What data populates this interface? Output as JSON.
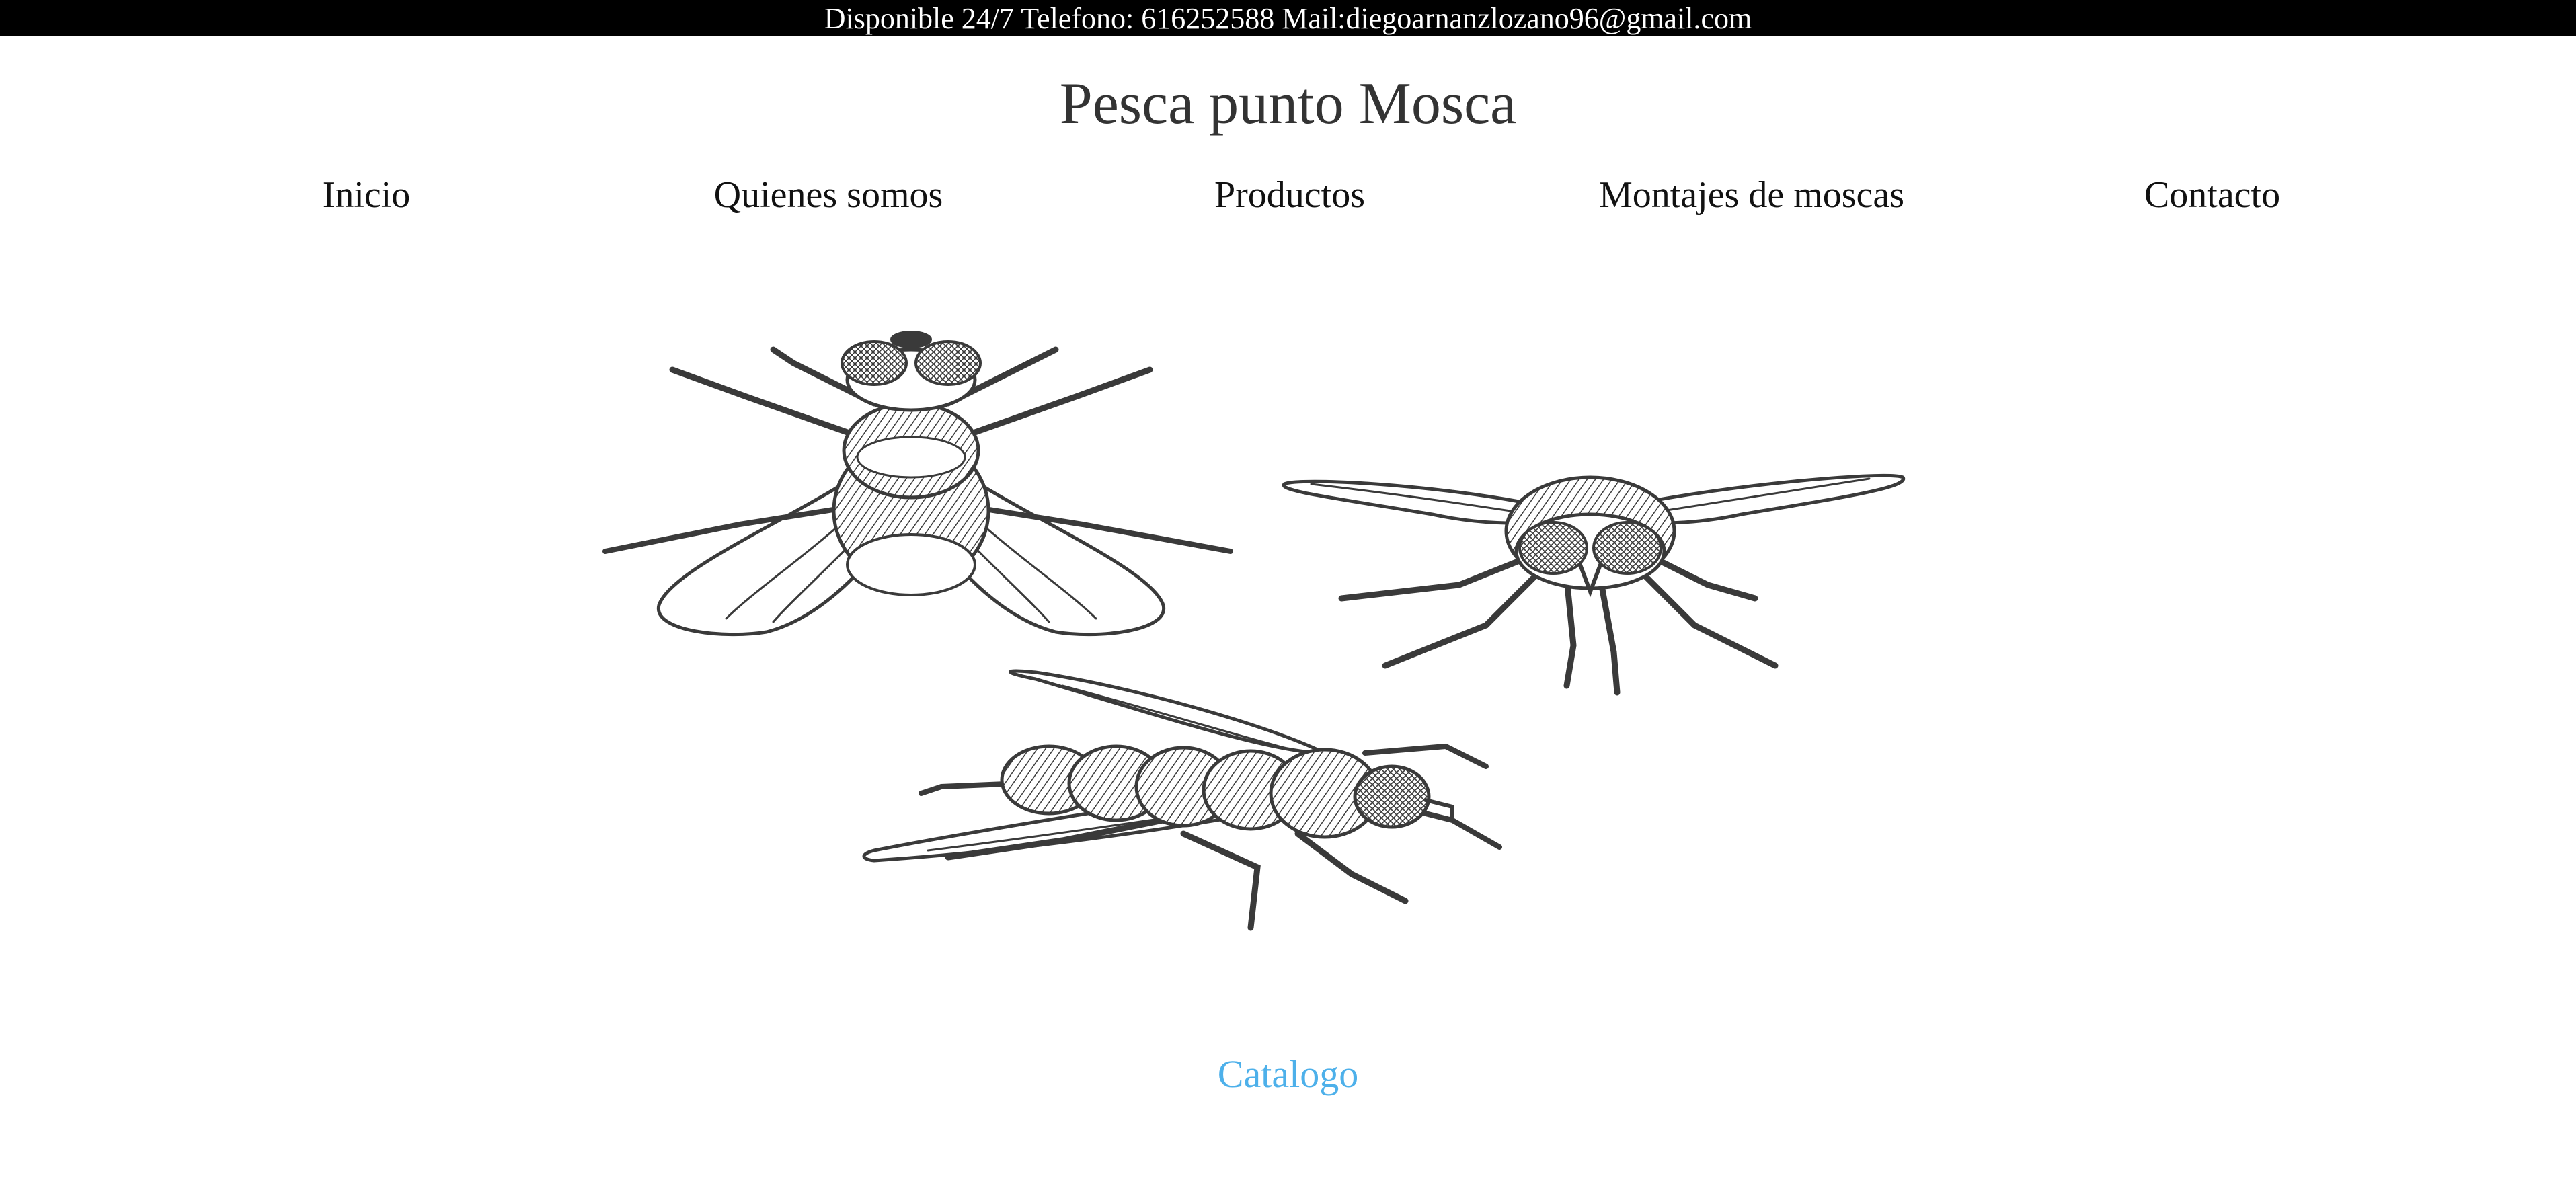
{
  "topbar": {
    "text": "Disponible 24/7 Telefono: 616252588 Mail:diegoarnanzlozano96@gmail.com"
  },
  "header": {
    "title": "Pesca punto Mosca"
  },
  "nav": {
    "items": [
      {
        "label": "Inicio"
      },
      {
        "label": "Quienes somos"
      },
      {
        "label": "Productos"
      },
      {
        "label": "Montajes de moscas"
      },
      {
        "label": "Contacto"
      }
    ]
  },
  "hero": {
    "image": "three-flies-illustration",
    "colors": {
      "ink": "#3a3a3a"
    }
  },
  "catalog": {
    "label": "Catalogo",
    "color": "#4db0ea"
  }
}
